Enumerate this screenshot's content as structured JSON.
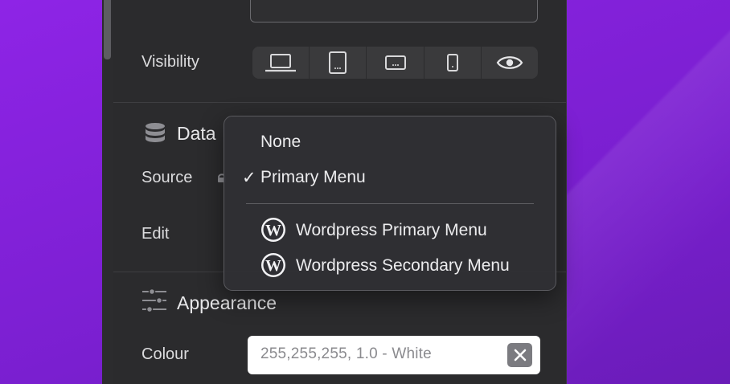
{
  "visibility": {
    "label": "Visibility",
    "devices": [
      "laptop-icon",
      "tablet-portrait-icon",
      "tablet-landscape-icon",
      "phone-icon",
      "eye-icon"
    ]
  },
  "data_section": {
    "title": "Data",
    "source_label": "Source",
    "edit_label": "Edit"
  },
  "dropdown": {
    "items": [
      {
        "label": "None",
        "checked": false
      },
      {
        "label": "Primary Menu",
        "checked": true,
        "check_mark": "✓"
      }
    ],
    "wordpress_items": [
      {
        "label": "Wordpress Primary Menu",
        "icon": "wordpress-icon"
      },
      {
        "label": "Wordpress Secondary Menu",
        "icon": "wordpress-icon"
      }
    ]
  },
  "appearance": {
    "title": "Appearance",
    "colour_label": "Colour",
    "colour_value": "255,255,255, 1.0 - White"
  },
  "colors": {
    "wallpaper": "#8e24e6",
    "panel": "#2b2b2d",
    "menu": "#2f2f34"
  }
}
